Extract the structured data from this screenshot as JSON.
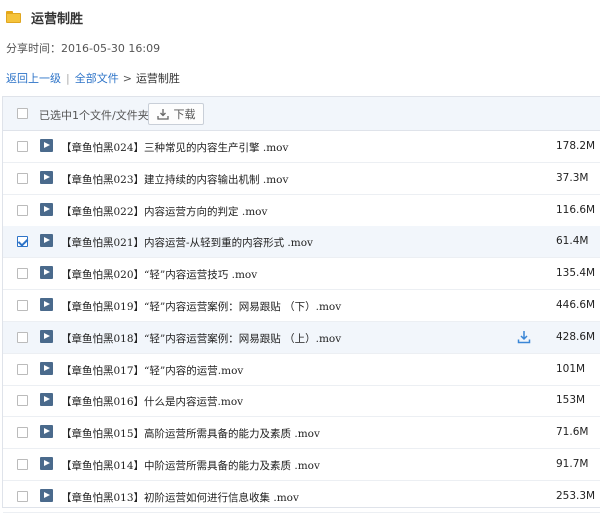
{
  "folder": {
    "title": "运营制胜"
  },
  "share": {
    "label": "分享时间：",
    "time": "2016-05-30 16:09"
  },
  "breadcrumb": {
    "back": "返回上一级",
    "sep": "|",
    "all": "全部文件",
    "arrow": ">",
    "current": "运营制胜"
  },
  "toolbar": {
    "selected_text": "已选中1个文件/文件夹",
    "download_label": "下载"
  },
  "files": [
    {
      "name": "【章鱼怕黑024】三种常见的内容生产引擎 .mov",
      "size": "178.2M",
      "checked": false
    },
    {
      "name": "【章鱼怕黑023】建立持续的内容输出机制 .mov",
      "size": "37.3M",
      "checked": false
    },
    {
      "name": "【章鱼怕黑022】内容运营方向的判定 .mov",
      "size": "116.6M",
      "checked": false
    },
    {
      "name": "【章鱼怕黑021】内容运营-从轻到重的内容形式 .mov",
      "size": "61.4M",
      "checked": true
    },
    {
      "name": "【章鱼怕黑020】“轻”内容运营技巧 .mov",
      "size": "135.4M",
      "checked": false
    },
    {
      "name": "【章鱼怕黑019】“轻”内容运营案例：网易跟贴 （下）.mov",
      "size": "446.6M",
      "checked": false
    },
    {
      "name": "【章鱼怕黑018】“轻”内容运营案例：网易跟贴 （上）.mov",
      "size": "428.6M",
      "checked": false
    },
    {
      "name": "【章鱼怕黑017】“轻”内容的运营.mov",
      "size": "101M",
      "checked": false
    },
    {
      "name": "【章鱼怕黑016】什么是内容运营.mov",
      "size": "153M",
      "checked": false
    },
    {
      "name": "【章鱼怕黑015】高阶运营所需具备的能力及素质 .mov",
      "size": "71.6M",
      "checked": false
    },
    {
      "name": "【章鱼怕黑014】中阶运营所需具备的能力及素质 .mov",
      "size": "91.7M",
      "checked": false
    },
    {
      "name": "【章鱼怕黑013】初阶运营如何进行信息收集 .mov",
      "size": "253.3M",
      "checked": false
    }
  ]
}
